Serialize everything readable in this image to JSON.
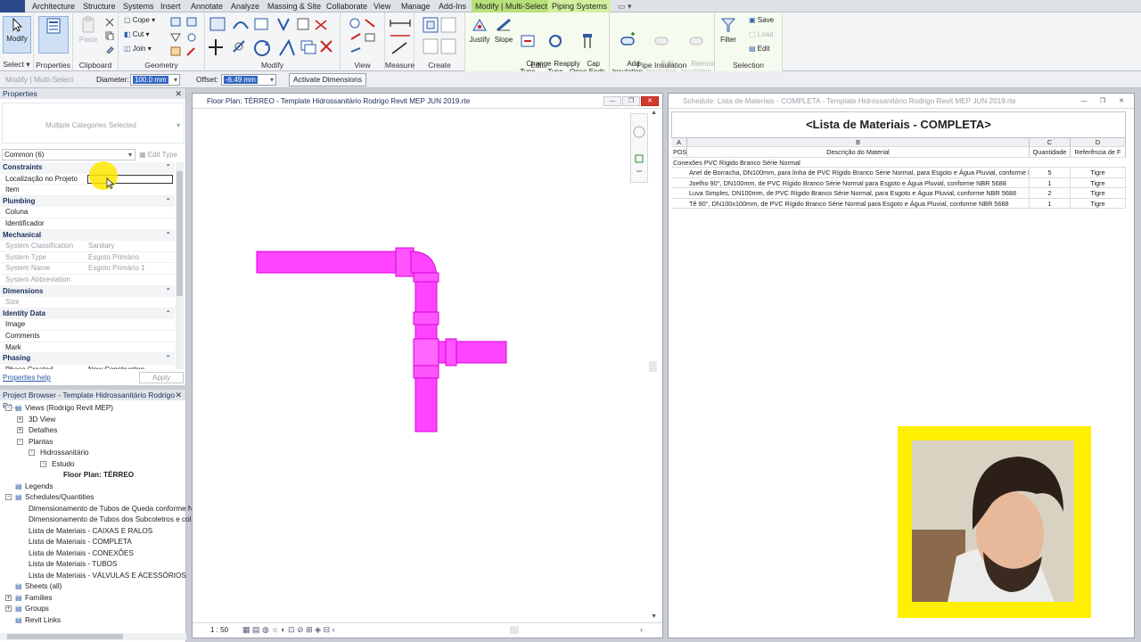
{
  "menu": {
    "tabs": [
      "Architecture",
      "Structure",
      "Systems",
      "Insert",
      "Annotate",
      "Analyze",
      "Massing & Site",
      "Collaborate",
      "View",
      "Manage",
      "Add-Ins"
    ],
    "context_tab_1": "Modify | Multi-Select",
    "context_tab_2": "Piping Systems"
  },
  "ribbon": {
    "select": {
      "modify_label": "Modify",
      "group_label": "Select"
    },
    "properties": {
      "label": "Properties"
    },
    "clipboard": {
      "paste_label": "Paste",
      "group_label": "Clipboard"
    },
    "geometry": {
      "cope": "Cope",
      "cut": "Cut",
      "join": "Join",
      "group_label": "Geometry"
    },
    "modify": {
      "group_label": "Modify"
    },
    "view": {
      "group_label": "View"
    },
    "measure": {
      "group_label": "Measure"
    },
    "create": {
      "group_label": "Create"
    },
    "edit": {
      "justify": "Justify",
      "slope": "Slope",
      "change_type": "Change\nType",
      "reapply_type": "Reapply\nType",
      "cap_open_ends": "Cap\nOpen Ends",
      "group_label": "Edit"
    },
    "insulation": {
      "add": "Add\nInsulation",
      "edit": "Edit\nInsulation",
      "remove": "Remove\nInsulation",
      "group_label": "Pipe Insulation"
    },
    "selection": {
      "filter": "Filter",
      "save": "Save",
      "load": "Load",
      "edit": "Edit",
      "group_label": "Selection"
    }
  },
  "options_bar": {
    "context": "Modify | Multi-Select",
    "diameter_label": "Diameter:",
    "diameter_value": "100.0 mm",
    "offset_label": "Offset:",
    "offset_value": "-6.49 mm",
    "activate_dimensions": "Activate Dimensions"
  },
  "properties": {
    "title": "Properties",
    "type_selector": "Multiple Categories Selected",
    "filter": "Common (6)",
    "edit_type": "Edit Type",
    "help": "Properties help",
    "apply": "Apply",
    "rows": [
      {
        "kind": "cat",
        "label": "Constraints"
      },
      {
        "kind": "row",
        "key": "Localização no Projeto",
        "value": "",
        "dim": false
      },
      {
        "kind": "row",
        "key": "Item",
        "value": "",
        "dim": false
      },
      {
        "kind": "cat",
        "label": "Plumbing"
      },
      {
        "kind": "row",
        "key": "Coluna",
        "value": "",
        "dim": false
      },
      {
        "kind": "row",
        "key": "Identificador",
        "value": "",
        "dim": false
      },
      {
        "kind": "cat",
        "label": "Mechanical"
      },
      {
        "kind": "row",
        "key": "System Classification",
        "value": "Sanitary",
        "dim": true
      },
      {
        "kind": "row",
        "key": "System Type",
        "value": "Esgoto Primário",
        "dim": true
      },
      {
        "kind": "row",
        "key": "System Name",
        "value": "Esgoto Primário 1",
        "dim": true
      },
      {
        "kind": "row",
        "key": "System Abbreviation",
        "value": "",
        "dim": true
      },
      {
        "kind": "cat",
        "label": "Dimensions"
      },
      {
        "kind": "row",
        "key": "Size",
        "value": "",
        "dim": true
      },
      {
        "kind": "cat",
        "label": "Identity Data"
      },
      {
        "kind": "row",
        "key": "Image",
        "value": "",
        "dim": false
      },
      {
        "kind": "row",
        "key": "Comments",
        "value": "",
        "dim": false
      },
      {
        "kind": "row",
        "key": "Mark",
        "value": "",
        "dim": false
      },
      {
        "kind": "cat",
        "label": "Phasing"
      },
      {
        "kind": "row",
        "key": "Phase Created",
        "value": "New Construction",
        "dim": false
      }
    ]
  },
  "browser": {
    "title": "Project Browser - Template Hidrossanitário Rodrigo Re...",
    "nodes": [
      {
        "label": "Views (Rodrigo Revit MEP)",
        "level": 0,
        "toggle": "-",
        "bold": false
      },
      {
        "label": "3D View",
        "level": 1,
        "toggle": "+",
        "bold": false
      },
      {
        "label": "Detalhes",
        "level": 1,
        "toggle": "+",
        "bold": false
      },
      {
        "label": "Plantas",
        "level": 1,
        "toggle": "-",
        "bold": false
      },
      {
        "label": "Hidrossanitário",
        "level": 2,
        "toggle": "-",
        "bold": false
      },
      {
        "label": "Estudo",
        "level": 3,
        "toggle": "-",
        "bold": false
      },
      {
        "label": "Floor Plan: TÉRREO",
        "level": 4,
        "toggle": "",
        "bold": true
      },
      {
        "label": "Legends",
        "level": 0,
        "toggle": "",
        "bold": false
      },
      {
        "label": "Schedules/Quantities",
        "level": 0,
        "toggle": "-",
        "bold": false
      },
      {
        "label": "Dimensionamento de Tubos de Queda conforme N",
        "level": 1,
        "toggle": "",
        "bold": false
      },
      {
        "label": "Dimensionamento de Tubos dos Subcoletros e col",
        "level": 1,
        "toggle": "",
        "bold": false
      },
      {
        "label": "Lista de Materiais - CAIXAS E RALOS",
        "level": 1,
        "toggle": "",
        "bold": false
      },
      {
        "label": "Lista de Materiais - COMPLETA",
        "level": 1,
        "toggle": "",
        "bold": false
      },
      {
        "label": "Lista de Materiais - CONEXÕES",
        "level": 1,
        "toggle": "",
        "bold": false
      },
      {
        "label": "Lista de Materiais - TUBOS",
        "level": 1,
        "toggle": "",
        "bold": false
      },
      {
        "label": "Lista de Materiais - VÁLVULAS E ACESSÓRIOS",
        "level": 1,
        "toggle": "",
        "bold": false
      },
      {
        "label": "Sheets (all)",
        "level": 0,
        "toggle": "",
        "bold": false
      },
      {
        "label": "Families",
        "level": 0,
        "toggle": "+",
        "bold": false
      },
      {
        "label": "Groups",
        "level": 0,
        "toggle": "+",
        "bold": false
      },
      {
        "label": "Revit Links",
        "level": 0,
        "toggle": "",
        "bold": false
      }
    ]
  },
  "floor_plan": {
    "title": "Floor Plan: TÉRREO - Template Hidrossanitário Rodrigo Revit MEP JUN 2019.rte",
    "scale": "1 : 50",
    "pipe_color": "#ff3cff"
  },
  "schedule": {
    "window_title": "Schedule: Lista de Materiais - COMPLETA - Template Hidrossanitário Rodrigo Revit MEP JUN 2019.rte",
    "heading": "<Lista de Materiais - COMPLETA>",
    "col_letters": [
      "A",
      "B",
      "C",
      "D"
    ],
    "col_headers": [
      "POS.",
      "Descrição do Material",
      "Quantidade",
      "Referência de F"
    ],
    "group_header": "Conexões PVC Rígido Branco Série Normal",
    "rows": [
      {
        "desc": "Anel de Borracha, DN100mm, para linha de PVC Rígido Branco Série Normal, para Esgoto e Água Pluvial, conforme NB",
        "qty": "5",
        "ref": "Tigre"
      },
      {
        "desc": "Joelho 90°, DN100mm, de PVC Rígido Branco Série Normal para Esgoto e Água Pluvial, conforme NBR 5688",
        "qty": "1",
        "ref": "Tigre"
      },
      {
        "desc": "Luva Simples, DN100mm, de PVC Rígido Branco Série Normal, para Esgoto e Água Pluvial, conforme NBR 5688",
        "qty": "2",
        "ref": "Tigre"
      },
      {
        "desc": "Tê 90°, DN100x100mm, de PVC Rígido Branco Série Normal para Esgoto e Água Pluvial, conforme NBR 5688",
        "qty": "1",
        "ref": "Tigre"
      }
    ]
  },
  "colors": {
    "context_tab": "#b7e07a",
    "webcam_border": "#ffef00",
    "selection_blue": "#3267c2"
  }
}
